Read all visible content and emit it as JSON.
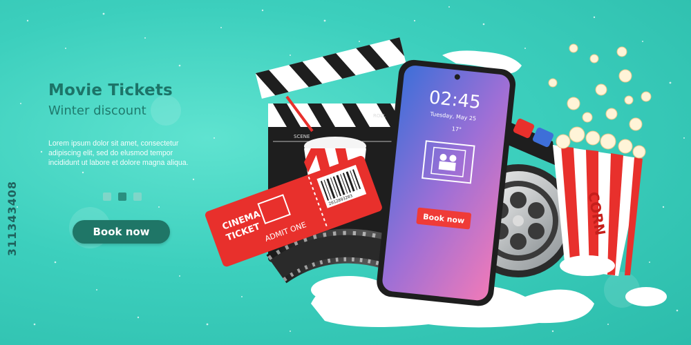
{
  "banner": {
    "title": "Movie Tickets",
    "subtitle": "Winter discount",
    "description": "Lorem ipsum dolor sit amet, consectetur adipiscing elit, sed do elusmod tempor incididunt ut labore et dolore magna aliqua.",
    "cta_label": "Book now",
    "carousel_total": 3,
    "carousel_active": 2
  },
  "phone": {
    "time": "02:45",
    "date": "Tuesday, May 25",
    "temperature": "17°",
    "cta_label": "Book now"
  },
  "ticket": {
    "line1": "CINEMA",
    "line2": "TICKET",
    "admit": "ADMIT ONE",
    "serial": "2012893203"
  },
  "clapper": {
    "scene_label": "SCENE",
    "roll_label": "ROLL"
  },
  "popcorn": {
    "label": "CORN"
  },
  "stock_id": "311343408",
  "colors": {
    "background": "#3ccfbd",
    "title": "#1c7468",
    "button": "#1f7667",
    "ticket_red": "#e8302c",
    "phone_cta": "#ef3b37"
  }
}
